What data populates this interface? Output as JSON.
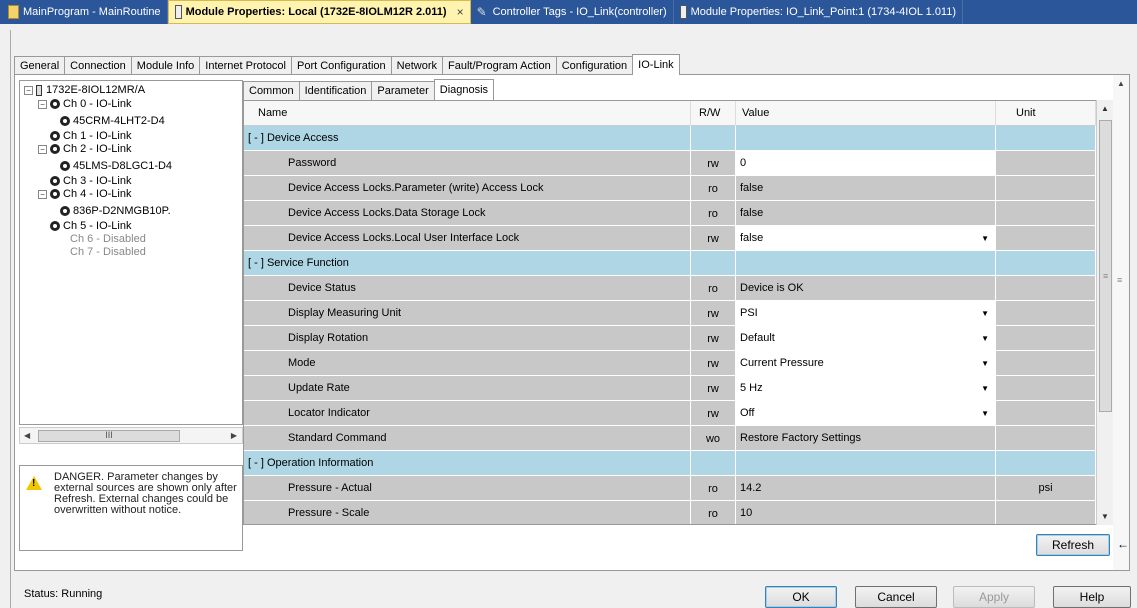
{
  "doc_tabs": [
    {
      "label": "MainProgram - MainRoutine",
      "icon": "program-icon",
      "active": false
    },
    {
      "label": "Module Properties: Local (1732E-8IOLM12R 2.011)",
      "icon": "module-icon",
      "active": true
    },
    {
      "label": "Controller Tags - IO_Link(controller)",
      "icon": "tag-icon",
      "active": false
    },
    {
      "label": "Module Properties: IO_Link_Point:1 (1734-4IOL 1.011)",
      "icon": "module-icon",
      "active": false
    }
  ],
  "close_glyph": "×",
  "outer_tabs": [
    "General",
    "Connection",
    "Module Info",
    "Internet Protocol",
    "Port Configuration",
    "Network",
    "Fault/Program Action",
    "Configuration",
    "IO-Link"
  ],
  "outer_active": "IO-Link",
  "tree": {
    "root": "1732E-8IOL12MR/A",
    "items": [
      {
        "label": "Ch 0 - IO-Link",
        "level": 1
      },
      {
        "label": "45CRM-4LHT2-D4",
        "level": 2
      },
      {
        "label": "Ch 1 - IO-Link",
        "level": 1
      },
      {
        "label": "Ch 2 - IO-Link",
        "level": 1
      },
      {
        "label": "45LMS-D8LGC1-D4",
        "level": 2
      },
      {
        "label": "Ch 3 - IO-Link",
        "level": 1
      },
      {
        "label": "Ch 4 - IO-Link",
        "level": 1
      },
      {
        "label": "836P-D2NMGB10P.",
        "level": 2
      },
      {
        "label": "Ch 5 - IO-Link",
        "level": 1
      },
      {
        "label": "Ch 6 - Disabled",
        "level": 1
      },
      {
        "label": "Ch 7 - Disabled",
        "level": 1
      }
    ],
    "hscroll_grip": "III"
  },
  "danger_text": "DANGER. Parameter changes by external sources are shown only after Refresh. External changes could be overwritten without notice.",
  "inner_tabs": [
    "Common",
    "Identification",
    "Parameter",
    "Diagnosis"
  ],
  "inner_active": "Diagnosis",
  "grid": {
    "headers": {
      "name": "Name",
      "rw": "R/W",
      "value": "Value",
      "unit": "Unit"
    },
    "rows": [
      {
        "type": "group",
        "name": "[ - ] Device Access"
      },
      {
        "type": "param",
        "name": "Password",
        "rw": "rw",
        "value": "0",
        "editable": true,
        "dropdown": false,
        "unit": ""
      },
      {
        "type": "param",
        "name": "Device Access Locks.Parameter (write) Access Lock",
        "rw": "ro",
        "value": "false",
        "editable": false,
        "dropdown": false,
        "unit": ""
      },
      {
        "type": "param",
        "name": "Device Access Locks.Data Storage Lock",
        "rw": "ro",
        "value": "false",
        "editable": false,
        "dropdown": false,
        "unit": ""
      },
      {
        "type": "param",
        "name": "Device Access Locks.Local User Interface Lock",
        "rw": "rw",
        "value": "false",
        "editable": true,
        "dropdown": true,
        "unit": ""
      },
      {
        "type": "group",
        "name": "[ - ] Service Function"
      },
      {
        "type": "param",
        "name": "Device Status",
        "rw": "ro",
        "value": "Device is OK",
        "editable": false,
        "dropdown": false,
        "unit": ""
      },
      {
        "type": "param",
        "name": "Display Measuring Unit",
        "rw": "rw",
        "value": "PSI",
        "editable": true,
        "dropdown": true,
        "unit": ""
      },
      {
        "type": "param",
        "name": "Display Rotation",
        "rw": "rw",
        "value": "Default",
        "editable": true,
        "dropdown": true,
        "unit": ""
      },
      {
        "type": "param",
        "name": "Mode",
        "rw": "rw",
        "value": "Current Pressure",
        "editable": true,
        "dropdown": true,
        "unit": ""
      },
      {
        "type": "param",
        "name": "Update Rate",
        "rw": "rw",
        "value": "5 Hz",
        "editable": true,
        "dropdown": true,
        "unit": ""
      },
      {
        "type": "param",
        "name": "Locator Indicator",
        "rw": "rw",
        "value": "Off",
        "editable": true,
        "dropdown": true,
        "unit": ""
      },
      {
        "type": "param",
        "name": "Standard Command",
        "rw": "wo",
        "value": "Restore Factory Settings",
        "editable": false,
        "dropdown": false,
        "unit": ""
      },
      {
        "type": "group",
        "name": "[ - ] Operation Information"
      },
      {
        "type": "param",
        "name": "Pressure - Actual",
        "rw": "ro",
        "value": "14.2",
        "editable": false,
        "dropdown": false,
        "unit": "psi"
      },
      {
        "type": "param",
        "name": "Pressure - Scale",
        "rw": "ro",
        "value": "10",
        "editable": false,
        "dropdown": false,
        "unit": ""
      }
    ]
  },
  "buttons": {
    "refresh": "Refresh",
    "ok": "OK",
    "cancel": "Cancel",
    "apply": "Apply",
    "help": "Help"
  },
  "status": "Status:  Running",
  "colors": {
    "group_row": "#aed6e5",
    "readonly_row": "#c8c8c8",
    "title_bar": "#2b579a",
    "active_doc_tab": "#fff3b0"
  }
}
